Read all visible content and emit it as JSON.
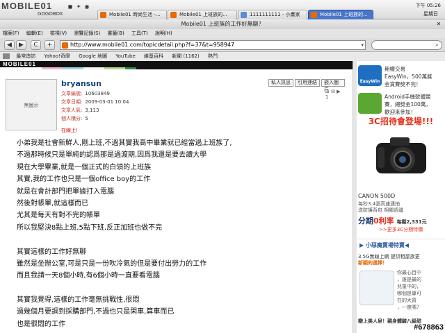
{
  "system": {
    "logo": "MOBILE01",
    "gogobox": "GOGOBOX",
    "clock": "下午 05:26",
    "day": "星期日"
  },
  "tabs": [
    {
      "label": "Mobile01 時尚生活 -..."
    },
    {
      "label": "Mobile01 上班族的..."
    },
    {
      "label": "1111111111 - 小畫家"
    },
    {
      "label": "Mobile01 上班族的..."
    }
  ],
  "window": {
    "title": "Mobile01 上班族的工作好無聊？"
  },
  "menu": [
    "檔案(F)",
    "編輯(E)",
    "檢視(V)",
    "瀏覽記錄(S)",
    "書籤(B)",
    "工具(T)",
    "說明(H)"
  ],
  "nav": {
    "back": "◀",
    "forward": "▶",
    "reload": "C",
    "new_tab": "+",
    "url": "http://www.mobile01.com/topicdetail.php?f=37&t=958947"
  },
  "bookmarks": [
    "最常造訪",
    "Yahoo!奇摩",
    "Google 地圖",
    "YouTube",
    "維基百科",
    "新聞 (1162)",
    "熱門"
  ],
  "site": {
    "logo": "MOBILE01"
  },
  "colors": {
    "strip": [
      "#f3b9c8",
      "#9fd3e8",
      "#f2f2f2",
      "#b9d98a",
      "#2e8b4e",
      "#111111"
    ],
    "accent": "#134a7a",
    "red": "#e6321e"
  },
  "post": {
    "avatar_text": "無圖示",
    "author": "bryansun",
    "meta": [
      {
        "label": "文章編號:",
        "value": "10603849"
      },
      {
        "label": "文章日期:",
        "value": "2009-03-01 10:04"
      },
      {
        "label": "文章人氣:",
        "value": "3,113"
      },
      {
        "label": "個人積分:",
        "value": "5"
      }
    ],
    "online": "在線上!",
    "buttons": [
      "私人訊息",
      "引用連結",
      "嵌入圖片"
    ],
    "tools": "⊞ ✉ ▶ 1",
    "body": [
      "小弟我是社會新鮮人,剛上班,不過其實我高中畢業就已經當過上班族了,",
      "不過那時候只是單純的認爲那是過渡期,因爲我還是要去讀大學",
      "現在大學畢業,就是一個正式的白領的上班族",
      "其實,我的工作也只是一個office boy的工作",
      "就是在會計部門把單據打入電腦",
      "然後對帳單,就這樣而已",
      "尤其是每天有對不完的帳單",
      "所以我堅決8點上班,5點下班,反正加班也做不完",
      "",
      "其實這樣的工作好無聊",
      "雖然是坐辦公室,可是只是一份吹冷氣的但是要付出勞力的工作",
      "而且我請一天8個小時,有6個小時一直要看電腦",
      "",
      "其實我覺得,這樣的工作毫無挑戰性,很悶",
      "過幾個月要調到採購部門,不過也只是閑車,算車而已",
      "也是很悶的工作"
    ]
  },
  "sidebar": {
    "ad1": {
      "brand": "EasyWin",
      "text": [
        "期權交易",
        "EasyWin，500萬獎",
        "金賞賽獎不完！"
      ]
    },
    "ad2": {
      "text": [
        "Android手機軟體競",
        "賽，總獎金100萬，",
        "歡迎來參加！"
      ]
    },
    "ad3_title": "3C招待會登場!!!",
    "camera": "CANON 500D",
    "promo": [
      "每秒3.4張高速連拍",
      "送防護背包 相關週邊"
    ],
    "rate_prefix": "分期",
    "rate_red": "0利率",
    "rate_suffix": "每期2,331元",
    "more": ">>更多3C分期特價",
    "section_title": "▶ 小惡魔賣場特賣◀",
    "ad4": {
      "title": "3.5G無線上網 提供租屋族更",
      "sub": "新穎的選擇！"
    },
    "ad5": [
      "你最心目中",
      "，誰是最的",
      "兒童中的，",
      "哪個是專可",
      "在的大貨",
      "，一度嗎？"
    ],
    "ad6": "戀上美人泉！親身體驗八級甜"
  },
  "watermark": "#678863"
}
